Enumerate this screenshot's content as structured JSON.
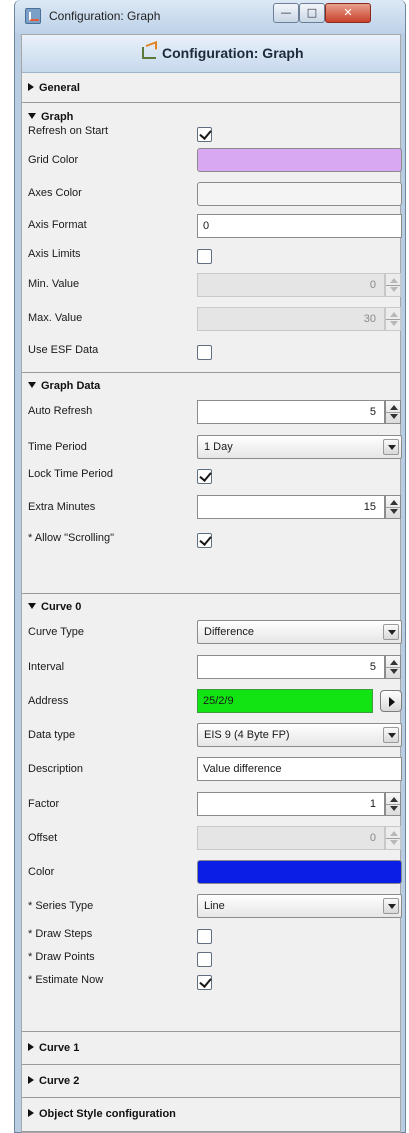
{
  "window": {
    "title": "Configuration: Graph",
    "min_glyph": "—",
    "max_glyph": "□",
    "close_glyph": "✕"
  },
  "panel": {
    "title": "Configuration: Graph"
  },
  "sections": {
    "general": {
      "label": "General",
      "expanded": false
    },
    "graph": {
      "label": "Graph",
      "expanded": true,
      "refresh_on_start": {
        "label": "Refresh on Start",
        "checked": true
      },
      "grid_color": {
        "label": "Grid Color",
        "color": "#d9a8f2"
      },
      "axes_color": {
        "label": "Axes Color",
        "color": "#f4f4f4"
      },
      "axis_format": {
        "label": "Axis Format",
        "value": "0"
      },
      "axis_limits": {
        "label": "Axis Limits",
        "checked": false
      },
      "min_value": {
        "label": "Min. Value",
        "value": "0"
      },
      "max_value": {
        "label": "Max. Value",
        "value": "30"
      },
      "use_esf": {
        "label": "Use ESF Data",
        "checked": false
      }
    },
    "graph_data": {
      "label": "Graph Data",
      "expanded": true,
      "auto_refresh": {
        "label": "Auto Refresh",
        "value": "5"
      },
      "time_period": {
        "label": "Time Period",
        "value": "1 Day"
      },
      "lock_time_period": {
        "label": "Lock Time Period",
        "checked": true
      },
      "extra_minutes": {
        "label": "Extra Minutes",
        "value": "15"
      },
      "allow_scrolling": {
        "label": "* Allow \"Scrolling\"",
        "checked": true
      }
    },
    "curve0": {
      "label": "Curve 0",
      "expanded": true,
      "curve_type": {
        "label": "Curve Type",
        "value": "Difference"
      },
      "interval": {
        "label": "Interval",
        "value": "5"
      },
      "address": {
        "label": "Address",
        "value": "25/2/9",
        "color": "#12e312"
      },
      "data_type": {
        "label": "Data type",
        "value": "EIS 9 (4 Byte FP)"
      },
      "description": {
        "label": "Description",
        "value": "Value difference"
      },
      "factor": {
        "label": "Factor",
        "value": "1"
      },
      "offset": {
        "label": "Offset",
        "value": "0"
      },
      "color": {
        "label": "Color",
        "color": "#0a1ee6"
      },
      "series_type": {
        "label": "* Series Type",
        "value": "Line"
      },
      "draw_steps": {
        "label": "* Draw Steps",
        "checked": false
      },
      "draw_points": {
        "label": "* Draw Points",
        "checked": false
      },
      "estimate_now": {
        "label": "* Estimate Now",
        "checked": true
      }
    },
    "curve1": {
      "label": "Curve 1",
      "expanded": false
    },
    "curve2": {
      "label": "Curve 2",
      "expanded": false
    },
    "object_style": {
      "label": "Object Style configuration",
      "expanded": false
    }
  }
}
